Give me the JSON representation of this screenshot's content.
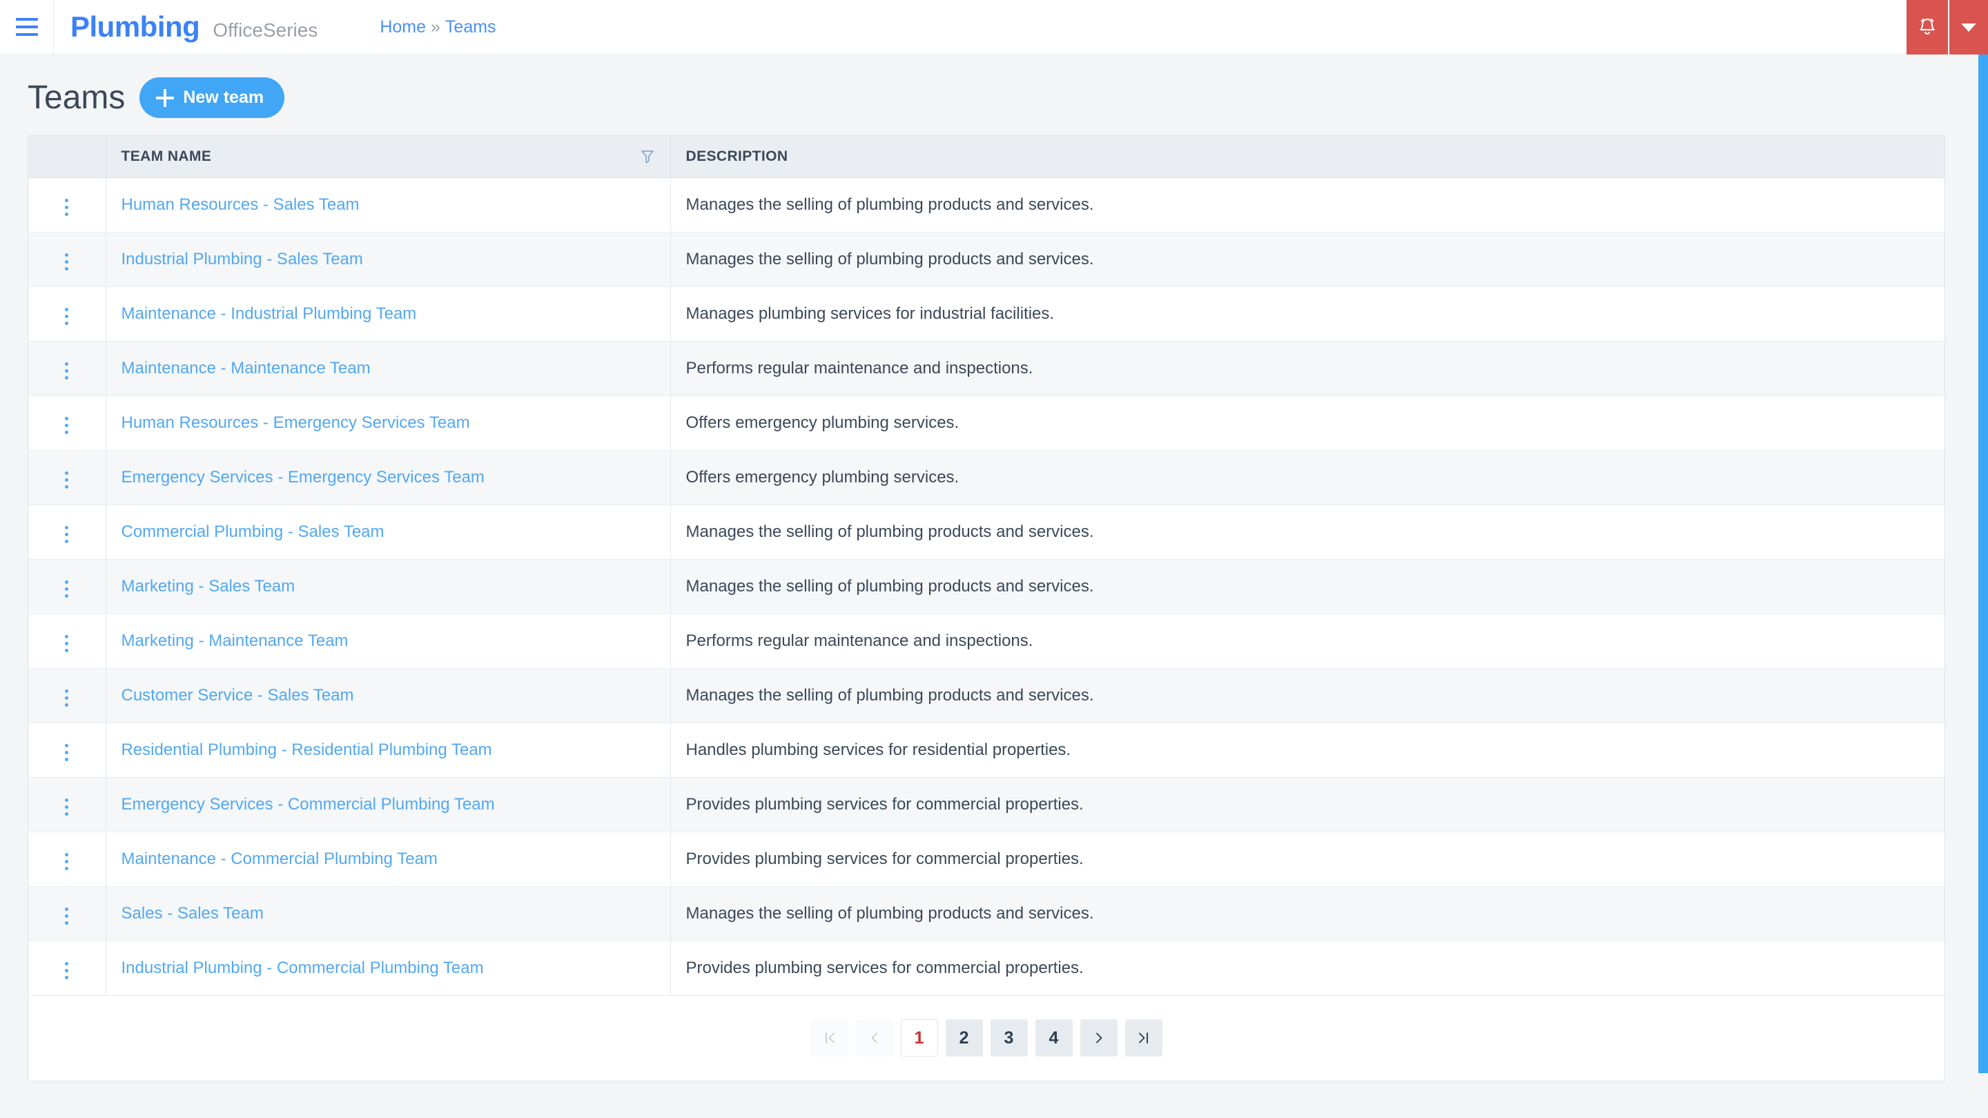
{
  "topbar": {
    "menu_icon": "hamburger-menu-icon",
    "brand_name": "Plumbing",
    "brand_sub": "OfficeSeries",
    "breadcrumb": {
      "home": "Home",
      "separator": "»",
      "current": "Teams"
    },
    "notification_icon": "bell-icon",
    "dropdown_icon": "caret-down-icon",
    "accent_red": "#d9534f",
    "accent_blue": "#3b82f6"
  },
  "page": {
    "title": "Teams",
    "new_button_label": "New team",
    "new_button_icon": "plus-icon",
    "new_button_color": "#41a6f5"
  },
  "table": {
    "columns": [
      "",
      "TEAM NAME",
      "DESCRIPTION"
    ],
    "filter_icon": "funnel-filter-icon",
    "row_menu_icon": "vertical-dots-icon",
    "rows": [
      {
        "name": "Human Resources - Sales Team",
        "description": "Manages the selling of plumbing products and services."
      },
      {
        "name": "Industrial Plumbing - Sales Team",
        "description": "Manages the selling of plumbing products and services."
      },
      {
        "name": "Maintenance - Industrial Plumbing Team",
        "description": "Manages plumbing services for industrial facilities."
      },
      {
        "name": "Maintenance - Maintenance Team",
        "description": "Performs regular maintenance and inspections."
      },
      {
        "name": "Human Resources - Emergency Services Team",
        "description": "Offers emergency plumbing services."
      },
      {
        "name": "Emergency Services - Emergency Services Team",
        "description": "Offers emergency plumbing services."
      },
      {
        "name": "Commercial Plumbing - Sales Team",
        "description": "Manages the selling of plumbing products and services."
      },
      {
        "name": "Marketing - Sales Team",
        "description": "Manages the selling of plumbing products and services."
      },
      {
        "name": "Marketing - Maintenance Team",
        "description": "Performs regular maintenance and inspections."
      },
      {
        "name": "Customer Service - Sales Team",
        "description": "Manages the selling of plumbing products and services."
      },
      {
        "name": "Residential Plumbing - Residential Plumbing Team",
        "description": "Handles plumbing services for residential properties."
      },
      {
        "name": "Emergency Services - Commercial Plumbing Team",
        "description": "Provides plumbing services for commercial properties."
      },
      {
        "name": "Maintenance - Commercial Plumbing Team",
        "description": "Provides plumbing services for commercial properties."
      },
      {
        "name": "Sales - Sales Team",
        "description": "Manages the selling of plumbing products and services."
      },
      {
        "name": "Industrial Plumbing - Commercial Plumbing Team",
        "description": "Provides plumbing services for commercial properties."
      }
    ]
  },
  "pagination": {
    "first_label": "|<",
    "prev_label": "‹",
    "next_label": "›",
    "last_label": ">|",
    "pages": [
      "1",
      "2",
      "3",
      "4"
    ],
    "current_page": "1",
    "active_color": "#c9302c"
  },
  "scrollbar": {
    "thumb_color": "#3ba7f7"
  }
}
